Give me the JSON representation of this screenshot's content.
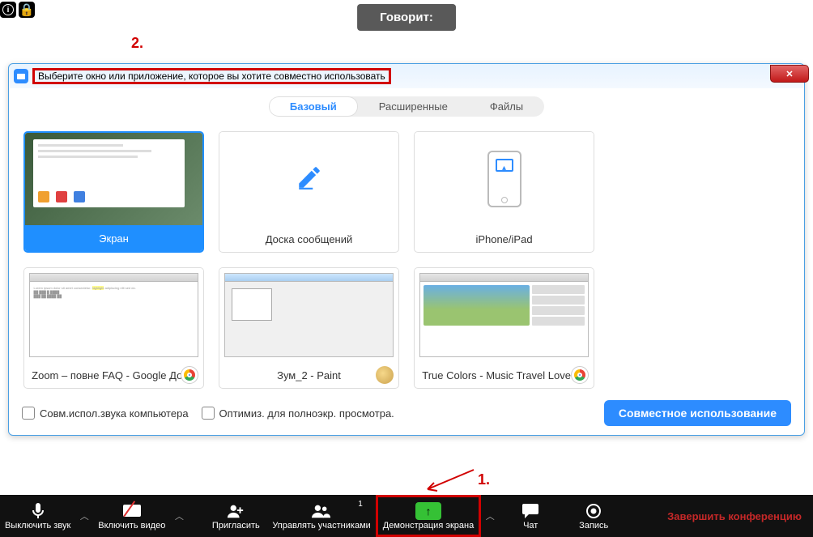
{
  "top": {
    "info_icon": "i",
    "lock_icon": "lock-icon"
  },
  "speaking_label": "Говорит:",
  "dialog": {
    "title": "Выберите окно или приложение, которое вы хотите совместно использовать",
    "tabs": {
      "basic": "Базовый",
      "advanced": "Расширенные",
      "files": "Файлы"
    },
    "cards": {
      "screen": "Экран",
      "whiteboard": "Доска сообщений",
      "iphone": "iPhone/iPad",
      "win1": "Zoom – повне FAQ - Google Док...",
      "win2": "Зум_2 - Paint",
      "win3": "True Colors - Music Travel Love (..."
    },
    "checks": {
      "audio": "Совм.испол.звука компьютера",
      "optimize": "Оптимиз. для полноэкр. просмотра."
    },
    "share_button": "Совместное использование"
  },
  "annotations": {
    "one": "1.",
    "two": "2."
  },
  "toolbar": {
    "mute": "Выключить звук",
    "video": "Включить видео",
    "invite": "Пригласить",
    "participants": "Управлять участниками",
    "participants_count": "1",
    "share": "Демонстрация экрана",
    "chat": "Чат",
    "record": "Запись",
    "end": "Завершить конференцию"
  }
}
